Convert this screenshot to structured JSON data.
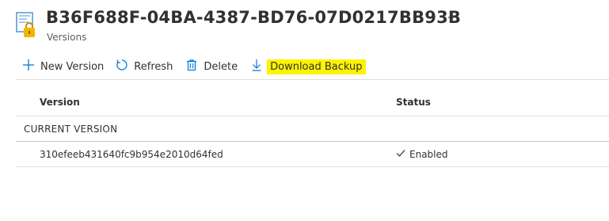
{
  "header": {
    "title": "B36F688F-04BA-4387-BD76-07D0217BB93B",
    "subtitle": "Versions",
    "resource_icon": "key-vault-certificate-icon",
    "more_icon": "ellipsis-icon"
  },
  "toolbar": {
    "new_version_label": "New Version",
    "refresh_label": "Refresh",
    "delete_label": "Delete",
    "download_backup_label": "Download Backup",
    "icons": [
      "plus-icon",
      "refresh-icon",
      "trash-icon",
      "download-icon"
    ],
    "highlight_color": "#fdf300",
    "accent_color": "#0078d4"
  },
  "table": {
    "columns": [
      "Version",
      "Status"
    ],
    "groups": [
      {
        "label": "CURRENT VERSION",
        "rows": [
          {
            "version": "310efeeb431640fc9b954e2010d64fed",
            "status": "Enabled",
            "status_icon": "checkmark-icon"
          }
        ]
      }
    ]
  }
}
